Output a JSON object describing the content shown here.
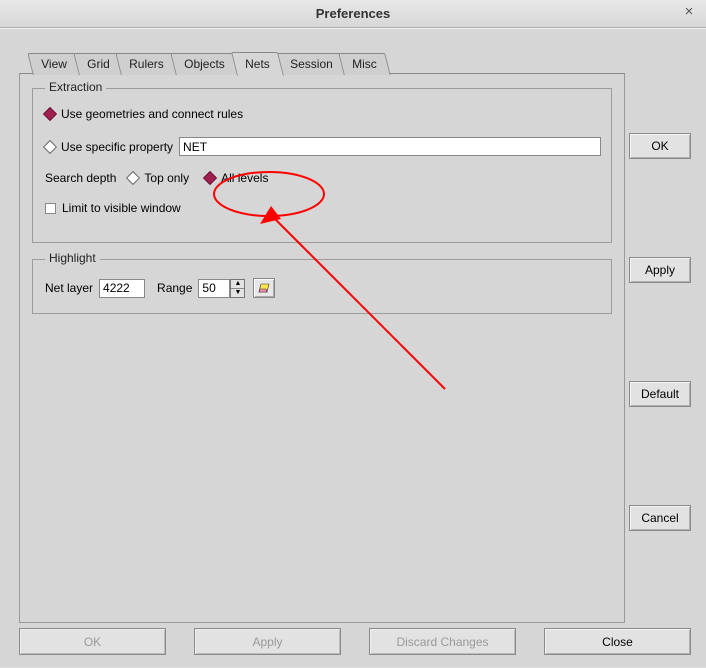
{
  "window": {
    "title": "Preferences",
    "close_glyph": "×"
  },
  "tabs": [
    "View",
    "Grid",
    "Rulers",
    "Objects",
    "Nets",
    "Session",
    "Misc"
  ],
  "active_tab_index": 4,
  "extraction": {
    "legend": "Extraction",
    "geometry_label": "Use geometries and connect rules",
    "geometry_selected": true,
    "specificprop_label": "Use specific property",
    "specificprop_selected": false,
    "specificprop_value": "NET",
    "searchdepth_label": "Search depth",
    "top_only_label": "Top only",
    "top_only_selected": false,
    "all_levels_label": "All levels",
    "all_levels_selected": true,
    "limit_label": "Limit to visible window",
    "limit_checked": false
  },
  "highlight": {
    "legend": "Highlight",
    "netlayer_label": "Net layer",
    "netlayer_value": "4222",
    "range_label": "Range",
    "range_value": "50"
  },
  "side_buttons": {
    "ok": "OK",
    "apply": "Apply",
    "default": "Default",
    "cancel": "Cancel"
  },
  "bottom_buttons": {
    "ok": "OK",
    "apply": "Apply",
    "discard": "Discard Changes",
    "close": "Close"
  }
}
